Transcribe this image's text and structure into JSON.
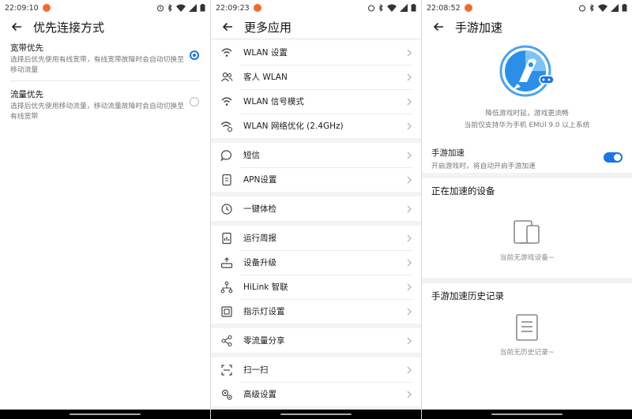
{
  "panel1": {
    "status_time": "22:09:10",
    "title": "优先连接方式",
    "options": [
      {
        "title": "宽带优先",
        "desc": "选择后优先使用有线宽带，有线宽带故障时会自动切换至移动流量",
        "selected": true
      },
      {
        "title": "流量优先",
        "desc": "选择后优先使用移动流量，移动流量故障时会自动切换至有线宽带",
        "selected": false
      }
    ]
  },
  "panel2": {
    "status_time": "22:09:23",
    "title": "更多应用",
    "groups": [
      [
        {
          "label": "WLAN 设置",
          "icon": "wifi-icon"
        },
        {
          "label": "客人 WLAN",
          "icon": "guest-users-icon"
        },
        {
          "label": "WLAN 信号模式",
          "icon": "wifi-signal-icon"
        },
        {
          "label": "WLAN 网络优化 (2.4GHz)",
          "icon": "wifi-optimize-icon"
        }
      ],
      [
        {
          "label": "短信",
          "icon": "message-icon"
        },
        {
          "label": "APN设置",
          "icon": "apn-icon"
        }
      ],
      [
        {
          "label": "一键体检",
          "icon": "checkup-icon"
        }
      ],
      [
        {
          "label": "运行周报",
          "icon": "report-icon"
        },
        {
          "label": "设备升级",
          "icon": "upgrade-icon"
        },
        {
          "label": "HiLink 智联",
          "icon": "hilink-icon"
        },
        {
          "label": "指示灯设置",
          "icon": "indicator-icon"
        }
      ],
      [
        {
          "label": "零流量分享",
          "icon": "share-icon"
        }
      ],
      [
        {
          "label": "扫一扫",
          "icon": "scan-icon"
        },
        {
          "label": "高级设置",
          "icon": "advanced-settings-icon"
        }
      ]
    ]
  },
  "panel3": {
    "status_time": "22:08:52",
    "title": "手游加速",
    "hero_line1": "降低游戏时延，游戏更流畅",
    "hero_line2": "当前仅支持华为手机 EMUI 9.0 以上系统",
    "toggle_title": "手游加速",
    "toggle_desc": "开启游戏时，将自动开启手游加速",
    "toggle_on": true,
    "section1_title": "正在加速的设备",
    "section1_empty": "当前无游戏设备~",
    "section2_title": "手游加速历史记录",
    "section2_empty": "当前无历史记录~"
  },
  "colors": {
    "accent": "#1a73e8",
    "notification": "#f26a2e",
    "divider": "#ececec"
  }
}
